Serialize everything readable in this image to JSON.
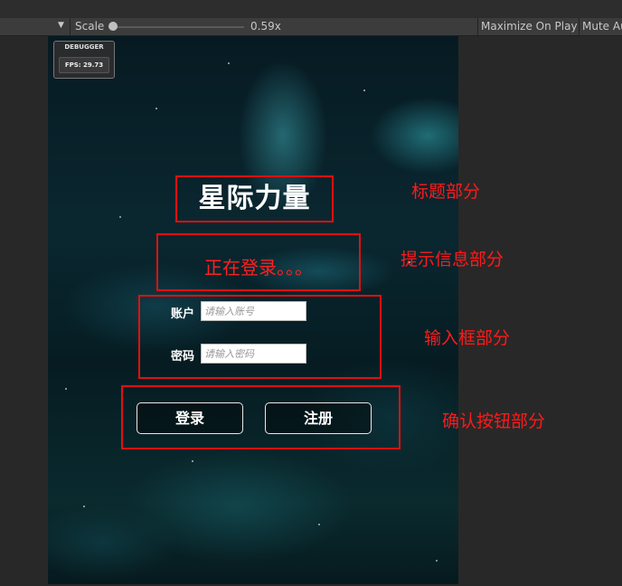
{
  "toolbar": {
    "dropdown_icon": "chevron-down-icon",
    "scale_label": "Scale",
    "scale_value": "0.59x",
    "scale_fraction": 0.0,
    "maximize_label": "Maximize On Play",
    "mute_label": "Mute Au"
  },
  "game": {
    "debugger": {
      "title": "DEBUGGER",
      "fps": "FPS: 29.73"
    },
    "title": "星际力量",
    "hint": "正在登录。。。",
    "account_label": "账户",
    "account_placeholder": "请输入账号",
    "password_label": "密码",
    "password_placeholder": "请输入密码",
    "login_button": "登录",
    "register_button": "注册"
  },
  "annotations": {
    "title_part": "标题部分",
    "hint_part": "提示信息部分",
    "input_part": "输入框部分",
    "button_part": "确认按钮部分"
  },
  "colors": {
    "annotation_red": "#ff1a1a",
    "box_red": "#e01010",
    "editor_bg": "#282828",
    "toolbar_bg": "#3c3c3c"
  }
}
